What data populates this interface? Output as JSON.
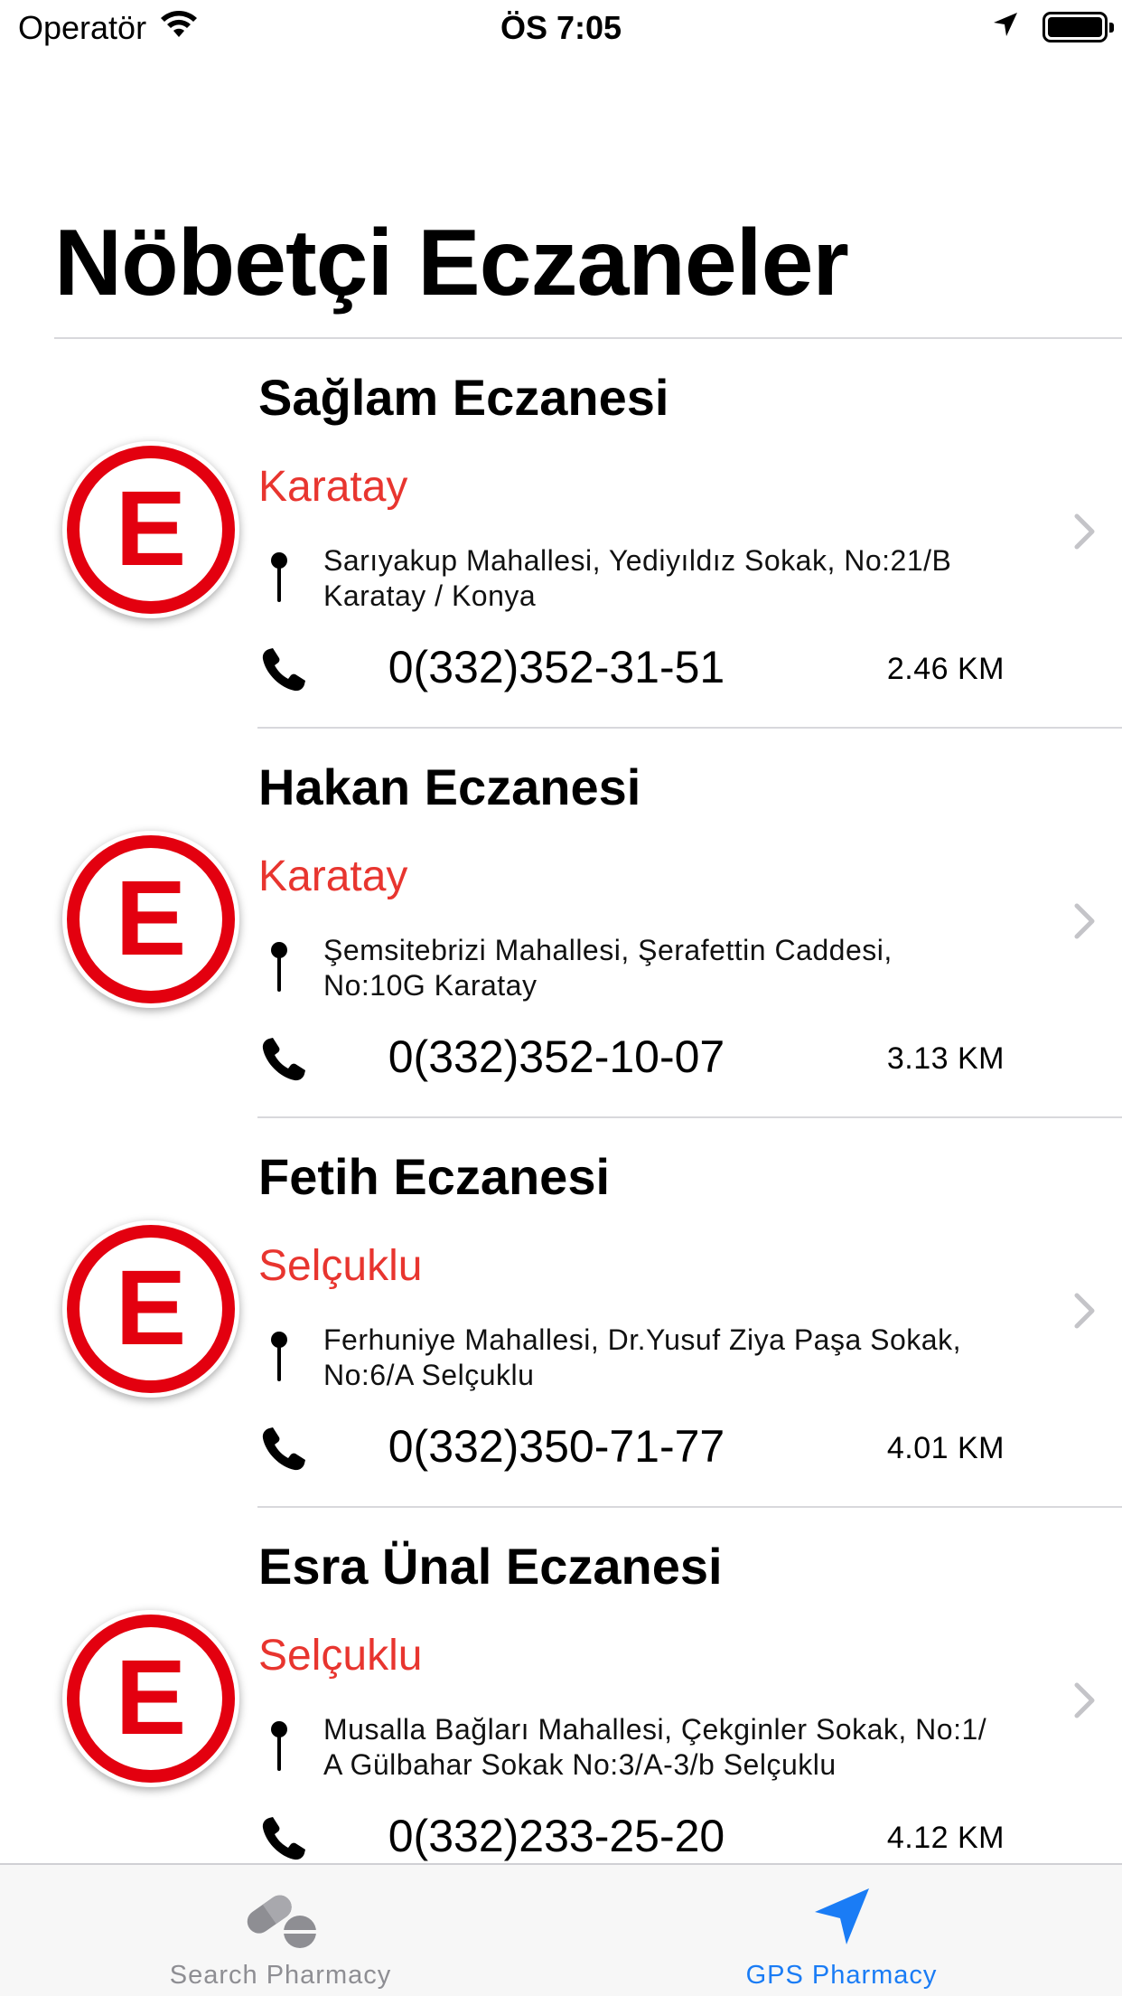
{
  "status_bar": {
    "carrier": "Operatör",
    "time": "ÖS 7:05",
    "battery_level": 1.0
  },
  "title": "Nöbetçi Eczaneler",
  "pharmacies": [
    {
      "name": "Sağlam Eczanesi",
      "district": "Karatay",
      "address_line1": "Sarıyakup Mahallesi, Yediyıldız Sokak, No:21/B",
      "address_line2": "Karatay / Konya",
      "phone": "0(332)352-31-51",
      "distance": "2.46 KM",
      "logo_letter": "E"
    },
    {
      "name": "Hakan Eczanesi",
      "district": "Karatay",
      "address_line1": "Şemsitebrizi Mahallesi, Şerafettin Caddesi,",
      "address_line2": "No:10G Karatay",
      "phone": "0(332)352-10-07",
      "distance": "3.13 KM",
      "logo_letter": "E"
    },
    {
      "name": "Fetih Eczanesi",
      "district": "Selçuklu",
      "address_line1": "Ferhuniye Mahallesi, Dr.Yusuf Ziya Paşa Sokak,",
      "address_line2": "No:6/A Selçuklu",
      "phone": "0(332)350-71-77",
      "distance": "4.01 KM",
      "logo_letter": "E"
    },
    {
      "name": "Esra Ünal Eczanesi",
      "district": "Selçuklu",
      "address_line1": "Musalla Bağları Mahallesi, Çekginler Sokak, No:1/",
      "address_line2": "A Gülbahar Sokak No:3/A-3/b Selçuklu",
      "phone": "0(332)233-25-20",
      "distance": "4.12 KM",
      "logo_letter": "E"
    }
  ],
  "tab_bar": {
    "tabs": [
      {
        "label": "Search Pharmacy",
        "icon": "pills-icon",
        "active": false
      },
      {
        "label": "GPS Pharmacy",
        "icon": "location-arrow-icon",
        "active": true
      }
    ]
  },
  "colors": {
    "district": "#e8352f",
    "logo_red": "#e3000f",
    "active_tab": "#1a7cf5",
    "inactive_tab": "#8e8e93"
  }
}
